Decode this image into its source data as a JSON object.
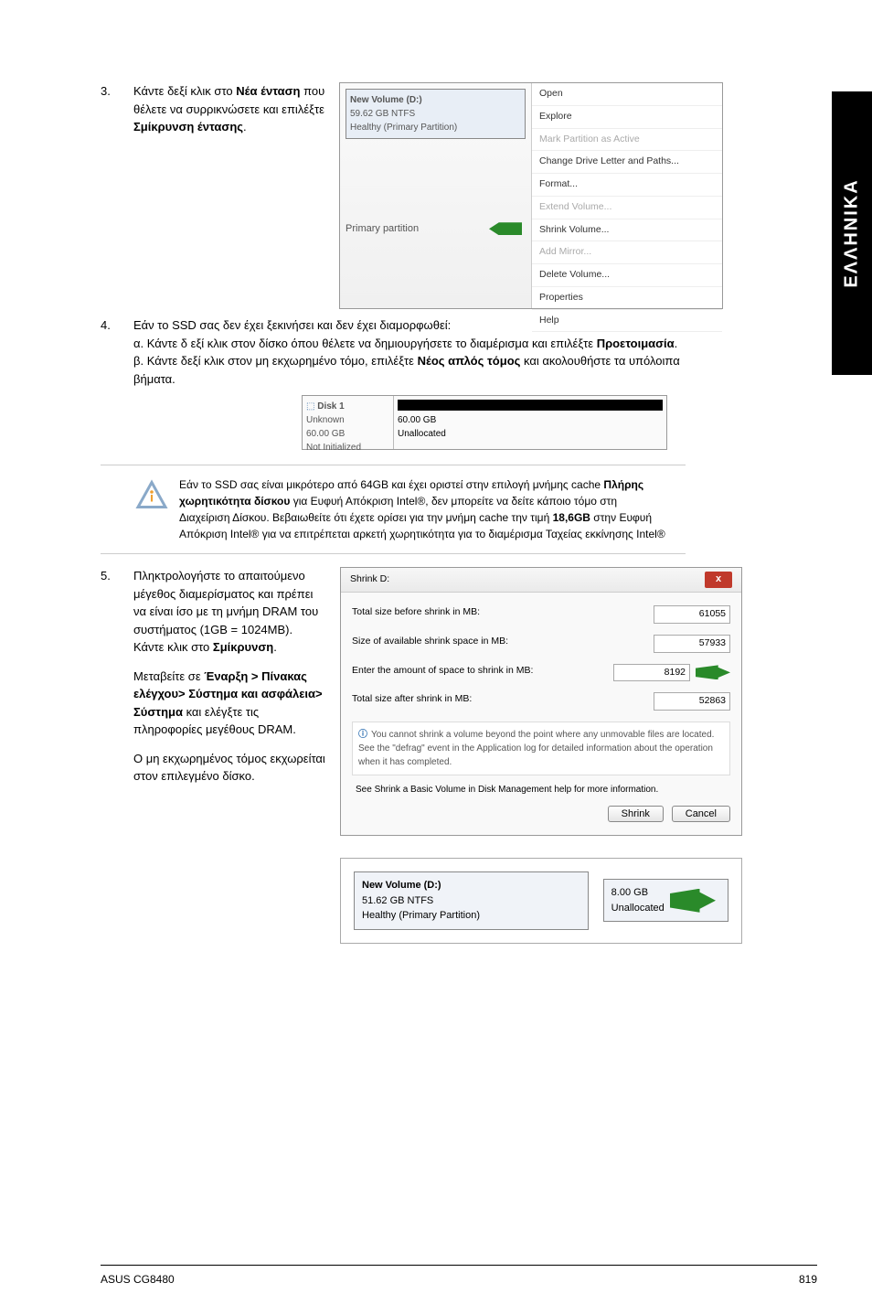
{
  "sidebar": {
    "label": "ΕΛΛΗΝΙΚΑ"
  },
  "step3": {
    "num": "3.",
    "line1": "Κάντε δεξί κλικ στο ",
    "bold1": "Νέα ένταση",
    "line2": " που θέλετε να συρρικνώσετε και επιλέξτε ",
    "bold2": "Σμίκρυνση έντασης",
    "dot": ".",
    "vol_title": "New Volume (D:)",
    "vol_sub1": "59.62 GB NTFS",
    "vol_sub2": "Healthy (Primary Partition)",
    "primary": "Primary partition",
    "menu": {
      "open": "Open",
      "explore": "Explore",
      "mark": "Mark Partition as Active",
      "change": "Change Drive Letter and Paths...",
      "format": "Format...",
      "extend": "Extend Volume...",
      "shrink": "Shrink Volume...",
      "addm": "Add Mirror...",
      "delete": "Delete Volume...",
      "props": "Properties",
      "help": "Help"
    }
  },
  "step4": {
    "num": "4.",
    "intro": "Εάν το SSD σας δεν έχει ξεκινήσει και δεν έχει διαμορφωθεί:",
    "a": "α. Κάντε δ εξί κλικ στον δίσκο όπου θέλετε να δημιουργήσετε το διαμέρισμα και επιλέξτε ",
    "a_bold": "Προετοιμασία",
    "a_dot": ".",
    "b": "β. Κάντε δεξί κλικ στον μη εκχωρημένο τόμο, επιλέξτε ",
    "b_bold": "Νέος απλός τόμος",
    "b_tail": " και ακολουθήστε τα υπόλοιπα βήματα.",
    "disk_label": "Disk 1",
    "disk_unknown": "Unknown",
    "disk_size": "60.00 GB",
    "disk_state": "Not Initialized",
    "disk_r_size": "60.00 GB",
    "disk_r_state": "Unallocated"
  },
  "note": {
    "text1": "Εάν το SSD σας είναι μικρότερο από 64GB και έχει οριστεί στην επιλογή μνήμης cache ",
    "bold1": "Πλήρης χωρητικότητα δίσκου",
    "text2": " για Ευφυή Απόκριση Intel®, δεν μπορείτε να δείτε κάποιο τόμο στη Διαχείριση Δίσκου. Βεβαιωθείτε ότι έχετε ορίσει για την μνήμη cache την τιμή ",
    "bold2": "18,6GB",
    "text3": " στην Ευφυή Απόκριση Intel® για να επιτρέπεται αρκετή χωρητικότητα για το διαμέρισμα Ταχείας εκκίνησης Intel®"
  },
  "step5": {
    "num": "5.",
    "p1a": "Πληκτρολογήστε το απαιτούμενο μέγεθος διαμερίσματος και πρέπει να είναι ίσο με τη μνήμη DRAM του συστήματος (1GB = 1024MB). Κάντε κλικ στο ",
    "p1b": "Σμίκρυνση",
    "p1c": ".",
    "p2a": "Μεταβείτε σε ",
    "p2b": "Έναρξη > Πίνακας ελέγχου> Σύστημα και ασφάλεια> Σύστημα",
    "p2c": " και ελέγξτε τις πληροφορίες μεγέθους DRAM.",
    "p3": "Ο μη εκχωρημένος τόμος εκχωρείται στον επιλεγμένο δίσκο.",
    "dlg_title": "Shrink D:",
    "r1": "Total size before shrink in MB:",
    "v1": "61055",
    "r2": "Size of available shrink space in MB:",
    "v2": "57933",
    "r3": "Enter the amount of space to shrink in MB:",
    "v3": "8192",
    "r4": "Total size after shrink in MB:",
    "v4": "52863",
    "info1": "You cannot shrink a volume beyond the point where any unmovable files are located. See the \"defrag\" event in the Application log for detailed information about the operation when it has completed.",
    "info2": "See Shrink a Basic Volume in Disk Management help for more information.",
    "btn_shrink": "Shrink",
    "btn_cancel": "Cancel",
    "after_vol": "New Volume (D:)",
    "after_sz": "51.62 GB NTFS",
    "after_h": "Healthy (Primary Partition)",
    "after_u1": "8.00 GB",
    "after_u2": "Unallocated"
  },
  "footer": {
    "left": "ASUS CG8480",
    "right": "819"
  }
}
